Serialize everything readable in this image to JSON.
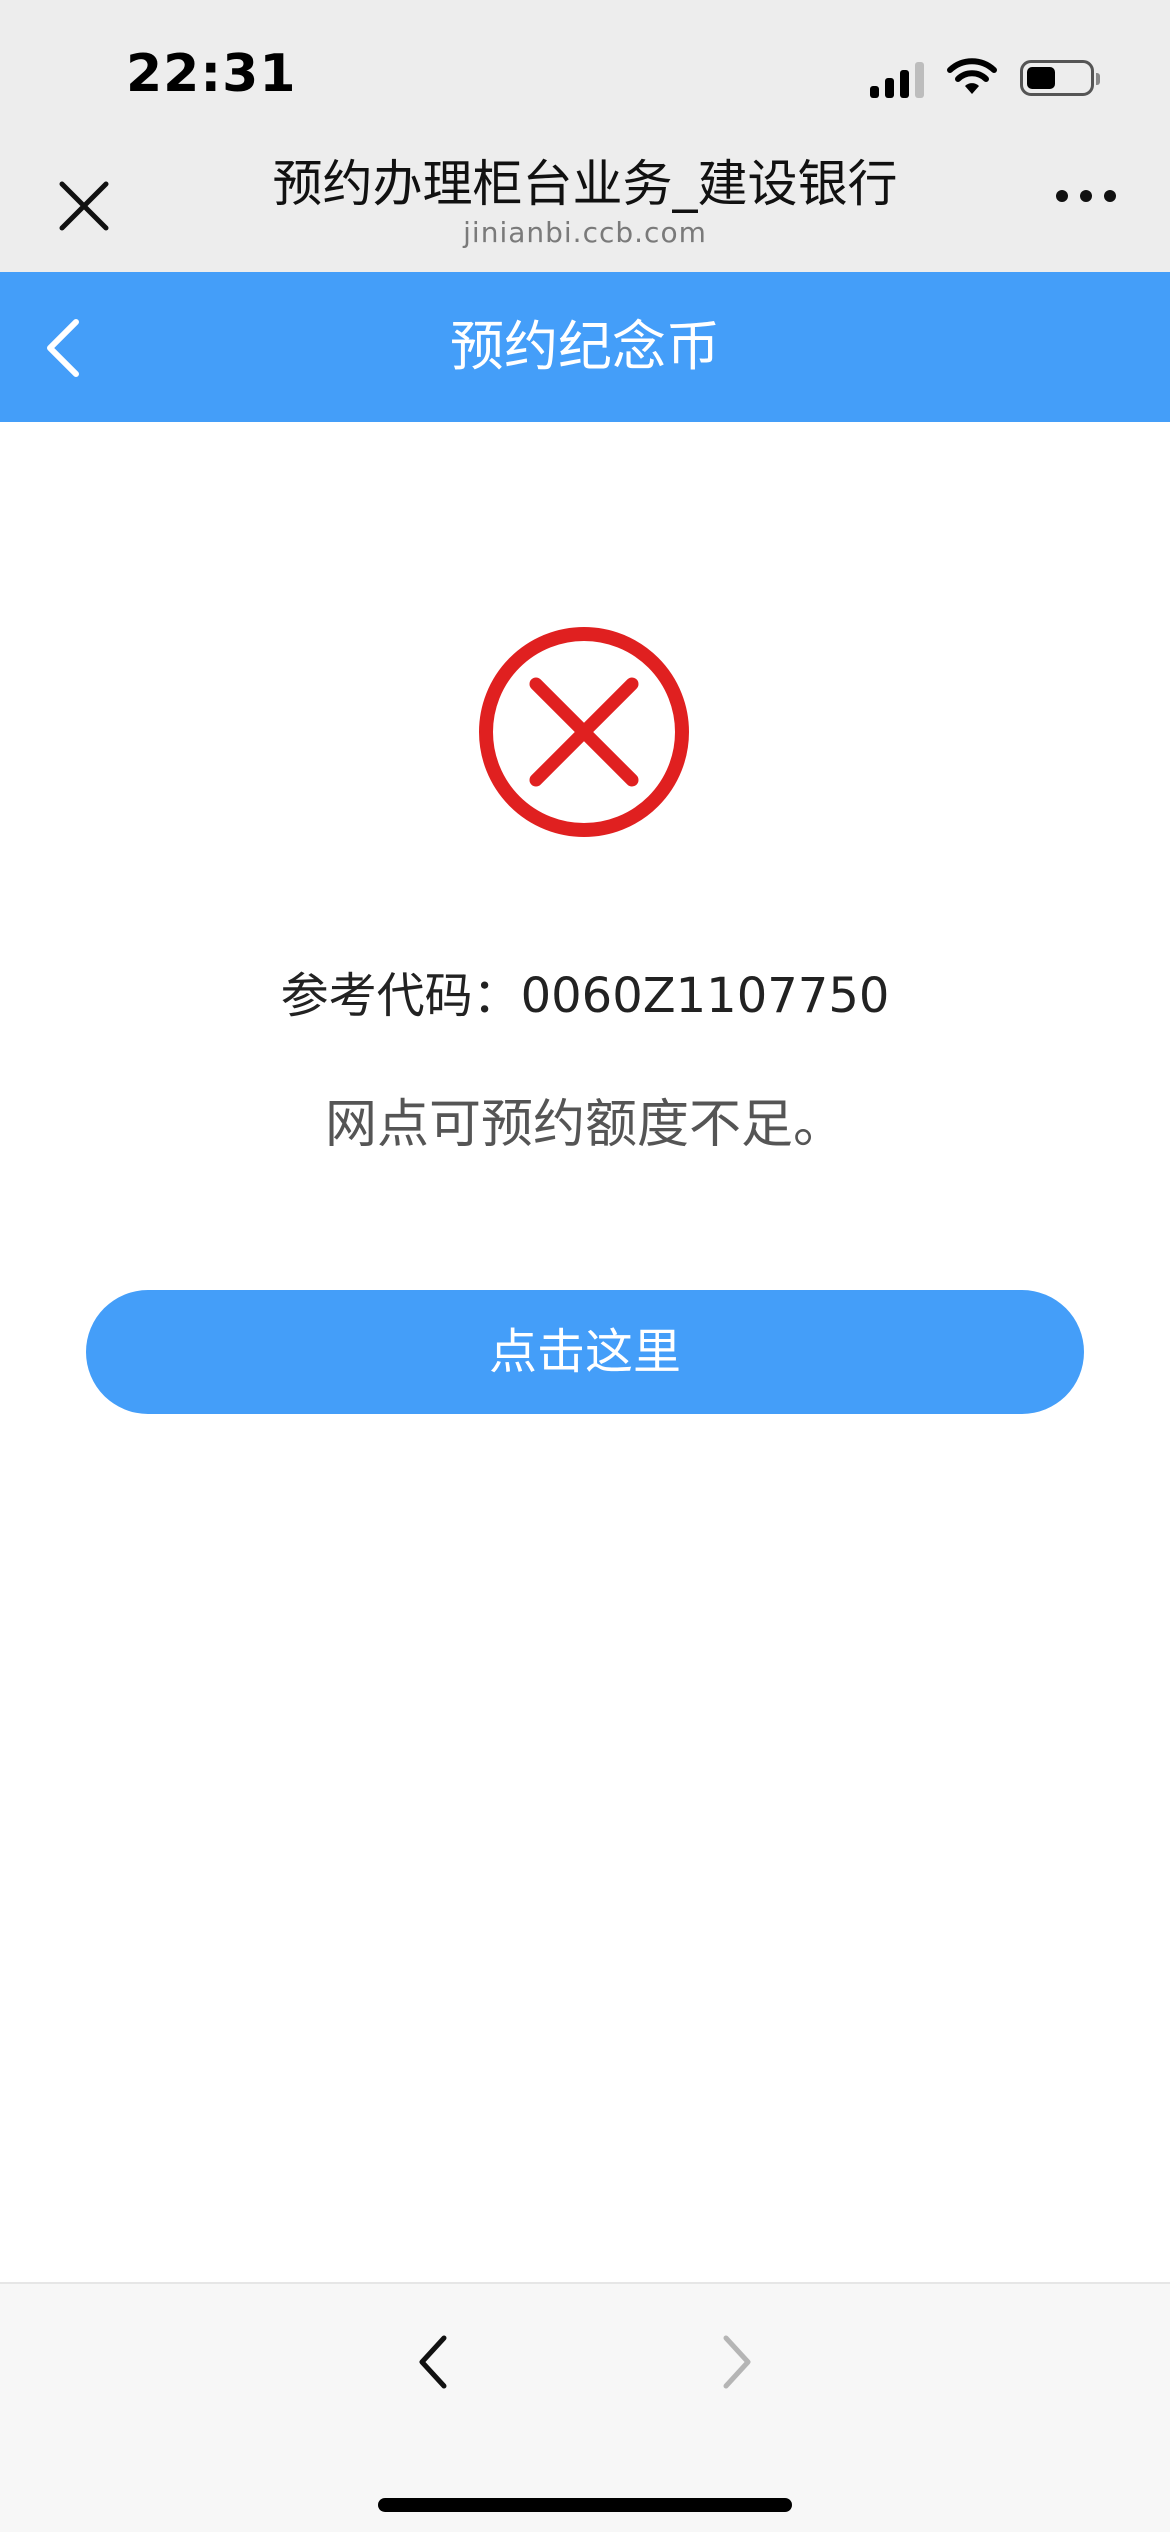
{
  "status_bar": {
    "time": "22:31"
  },
  "browser": {
    "title": "预约办理柜台业务_建设银行",
    "url": "jinianbi.ccb.com"
  },
  "header": {
    "title": "预约纪念币"
  },
  "result": {
    "icon": "error-x-circle-icon",
    "reference_code": "参考代码：0060Z1107750",
    "message": "网点可预约额度不足。"
  },
  "action": {
    "button_label": "点击这里"
  },
  "colors": {
    "brand_blue": "#449ef9",
    "error_red": "#e02020"
  }
}
